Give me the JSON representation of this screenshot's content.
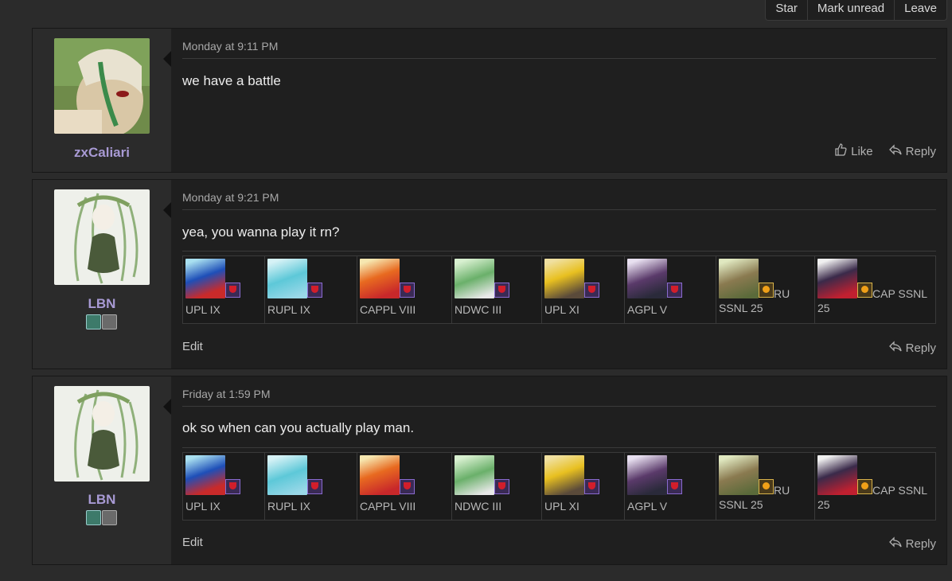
{
  "topbar": {
    "star": "Star",
    "mark_unread": "Mark unread",
    "leave": "Leave"
  },
  "colors": {
    "username": "#a89ad4",
    "background": "#2b2b2b",
    "panel": "#1f1f1f"
  },
  "posts": [
    {
      "username": "zxCaliari",
      "date": "Monday at 9:11 PM",
      "message": "we have a battle",
      "actions": {
        "like": "Like",
        "reply": "Reply"
      }
    },
    {
      "username": "LBN",
      "date": "Monday at 9:21 PM",
      "message": "yea, you wanna play it rn?",
      "edit": "Edit",
      "actions": {
        "reply": "Reply"
      }
    },
    {
      "username": "LBN",
      "date": "Friday at 1:59 PM",
      "message": "ok so when can you actually play man.",
      "edit": "Edit",
      "actions": {
        "reply": "Reply"
      }
    }
  ],
  "trophies": [
    {
      "label": "UPL IX",
      "tag": ""
    },
    {
      "label": "RUPL IX",
      "tag": ""
    },
    {
      "label": "CAPPL VIII",
      "tag": ""
    },
    {
      "label": "NDWC III",
      "tag": ""
    },
    {
      "label": "UPL XI",
      "tag": ""
    },
    {
      "label": "AGPL V",
      "tag": ""
    },
    {
      "label": "SSNL 25",
      "tag": "RU"
    },
    {
      "label": "25",
      "tag": "CAP SSNL"
    }
  ]
}
